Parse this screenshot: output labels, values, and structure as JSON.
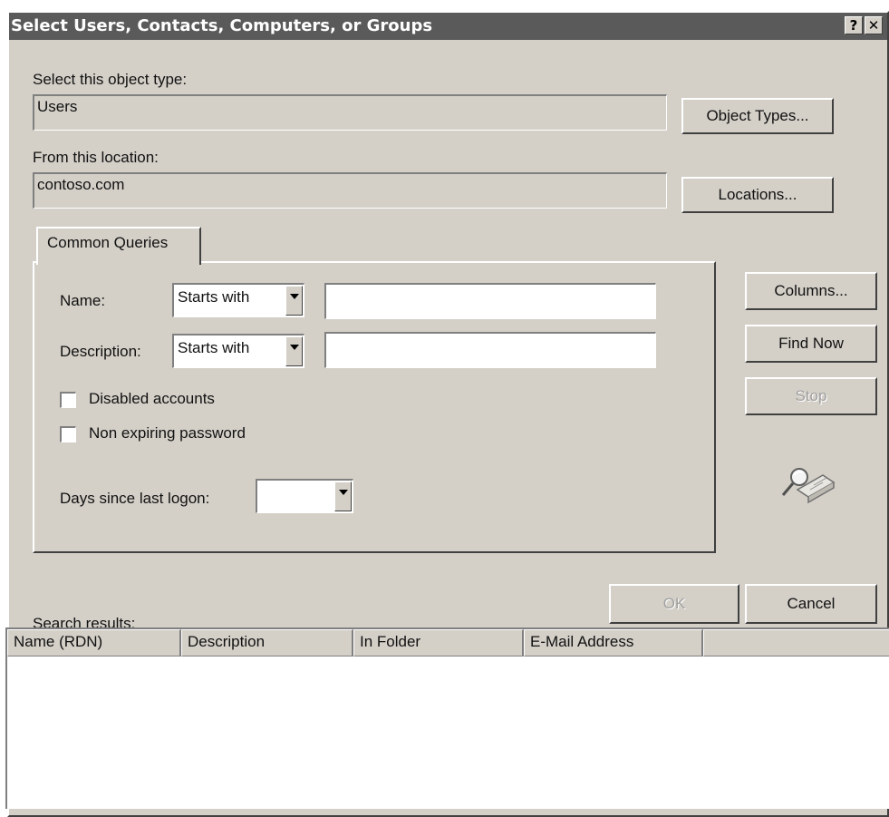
{
  "window": {
    "title": "Select Users, Contacts, Computers, or Groups",
    "help_glyph": "?",
    "close_glyph": "✕"
  },
  "object_type": {
    "label": "Select this object type:",
    "value": "Users",
    "button": "Object Types..."
  },
  "location": {
    "label": "From this location:",
    "value": "contoso.com",
    "button": "Locations..."
  },
  "queries": {
    "tab_label": "Common Queries",
    "name_label": "Name:",
    "name_mode": "Starts with",
    "name_value": "",
    "description_label": "Description:",
    "description_mode": "Starts with",
    "description_value": "",
    "disabled_accounts_label": "Disabled accounts",
    "disabled_accounts_checked": false,
    "non_expiring_label": "Non expiring password",
    "non_expiring_checked": false,
    "days_label": "Days since last logon:",
    "days_value": ""
  },
  "side_buttons": {
    "columns": "Columns...",
    "find_now": "Find Now",
    "stop": "Stop"
  },
  "dialog_buttons": {
    "ok": "OK",
    "cancel": "Cancel"
  },
  "results": {
    "label": "Search results:",
    "columns": [
      "Name (RDN)",
      "Description",
      "In Folder",
      "E-Mail Address"
    ],
    "rows": []
  },
  "icons": {
    "search_graphic": "magnifier-search-icon"
  }
}
